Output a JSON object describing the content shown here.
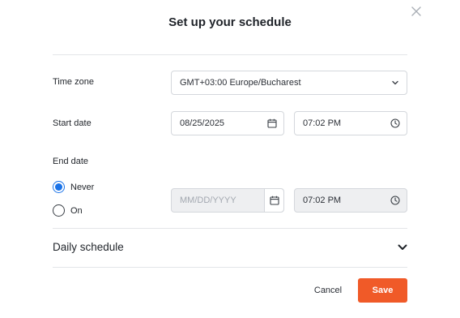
{
  "dialog": {
    "title": "Set up your schedule",
    "close_icon": "close-icon"
  },
  "time_zone": {
    "label": "Time zone",
    "value": "GMT+03:00 Europe/Bucharest",
    "icon": "chevron-down-icon"
  },
  "start": {
    "label": "Start date",
    "date_value": "08/25/2025",
    "date_icon": "calendar-icon",
    "time_value": "07:02 PM",
    "time_icon": "clock-icon"
  },
  "end": {
    "label": "End date",
    "options": [
      {
        "label": "Never",
        "selected": true
      },
      {
        "label": "On",
        "selected": false
      }
    ],
    "date_placeholder": "MM/DD/YYYY",
    "date_icon": "calendar-icon",
    "time_value": "07:02 PM",
    "time_icon": "clock-icon"
  },
  "daily_schedule": {
    "title": "Daily schedule",
    "icon": "chevron-down-icon"
  },
  "footer": {
    "cancel_label": "Cancel",
    "save_label": "Save",
    "save_color": "#f05a28"
  },
  "colors": {
    "accent": "#1a73e8",
    "primary_button": "#f05a28",
    "disabled_field": "#eeeff1"
  }
}
